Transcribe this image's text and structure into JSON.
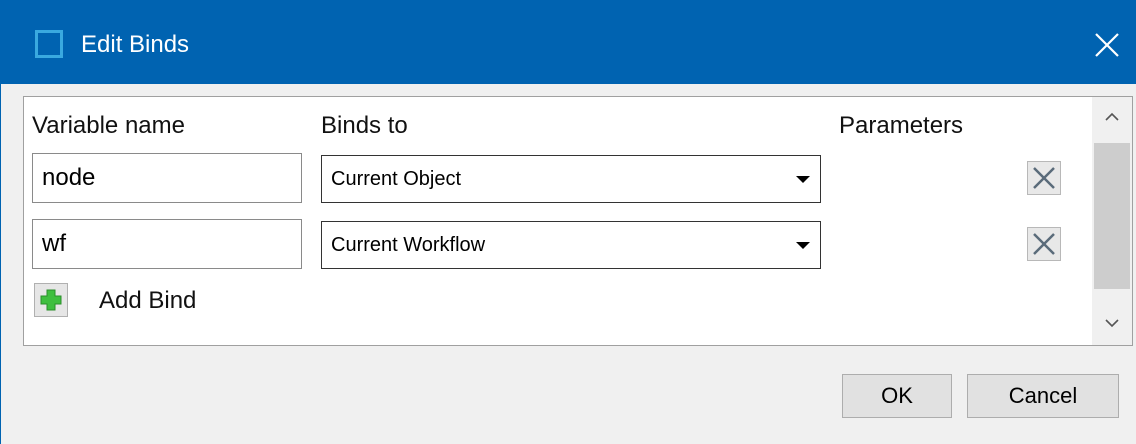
{
  "window": {
    "title": "Edit Binds"
  },
  "columns": {
    "variable_name": "Variable name",
    "binds_to": "Binds to",
    "parameters": "Parameters"
  },
  "binds": [
    {
      "variable": "node",
      "binds_to": "Current Object"
    },
    {
      "variable": "wf",
      "binds_to": "Current Workflow"
    }
  ],
  "add_bind_label": "Add Bind",
  "buttons": {
    "ok": "OK",
    "cancel": "Cancel"
  },
  "colors": {
    "titlebar": "#0063b1",
    "add_icon": "#3fbf3f"
  }
}
